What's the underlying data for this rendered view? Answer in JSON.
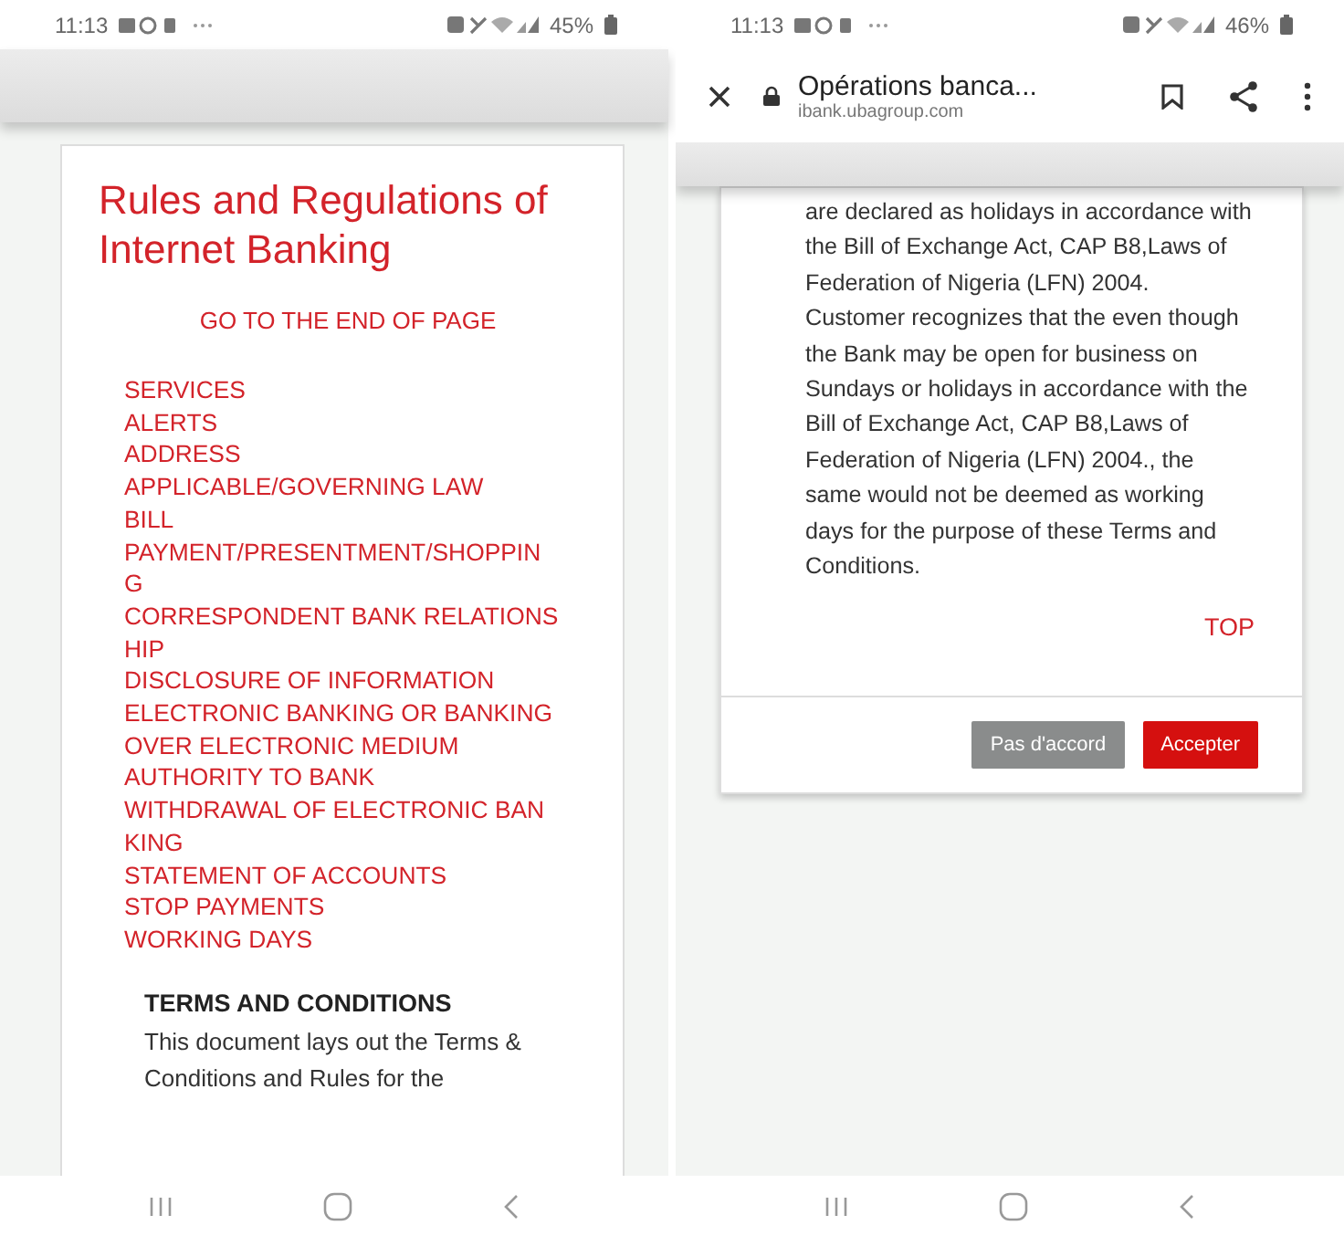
{
  "left": {
    "status_bar": {
      "time": "11:13",
      "battery": "45%"
    },
    "page": {
      "title": "Rules and Regulations of Internet Banking",
      "goto_link": "GO TO THE END OF PAGE",
      "links": [
        "SERVICES",
        "ALERTS",
        "ADDRESS",
        "APPLICABLE/GOVERNING LAW",
        "BILL",
        "PAYMENT/PRESENTMENT/SHOPPING",
        "CORRESPONDENT BANK RELATIONSHIP",
        "DISCLOSURE OF INFORMATION",
        "ELECTRONIC BANKING OR BANKING OVER ELECTRONIC MEDIUM",
        "AUTHORITY TO BANK",
        "WITHDRAWAL OF ELECTRONIC BANKING",
        "STATEMENT OF ACCOUNTS",
        "STOP PAYMENTS",
        "WORKING DAYS"
      ],
      "section_heading": "TERMS AND CONDITIONS",
      "paragraph": "This document lays out the Terms & Conditions and Rules for the"
    }
  },
  "right": {
    "status_bar": {
      "time": "11:13",
      "battery": "46%"
    },
    "browser": {
      "title": "Opérations banca...",
      "url": "ibank.ubagroup.com"
    },
    "page": {
      "paragraph": "are declared as holidays in accordance with the Bill of Exchange Act, CAP B8,Laws of Federation of Nigeria (LFN) 2004. Customer recognizes that the even though the Bank may be open for business on Sundays or holidays in accordance with the Bill of Exchange Act, CAP B8,Laws of Federation of Nigeria (LFN) 2004., the same would not be deemed as working days for the purpose of these Terms and Conditions.",
      "top_link": "TOP"
    },
    "buttons": [
      {
        "label": "Pas d'accord",
        "kind": "secondary"
      },
      {
        "label": "Accepter",
        "kind": "primary"
      }
    ]
  }
}
